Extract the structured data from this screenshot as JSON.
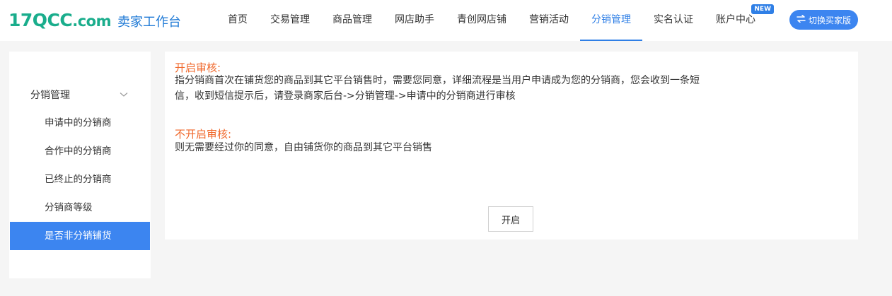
{
  "header": {
    "logo_text": "17QCC",
    "logo_domain": ".com",
    "logo_subtitle": "卖家工作台",
    "nav": [
      {
        "label": "首页",
        "active": false
      },
      {
        "label": "交易管理",
        "active": false
      },
      {
        "label": "商品管理",
        "active": false
      },
      {
        "label": "网店助手",
        "active": false
      },
      {
        "label": "青创网店铺",
        "active": false
      },
      {
        "label": "营销活动",
        "active": false
      },
      {
        "label": "分销管理",
        "active": true
      },
      {
        "label": "实名认证",
        "active": false
      },
      {
        "label": "账户中心",
        "active": false,
        "badge": "NEW"
      }
    ],
    "switch_button": "切换买家版",
    "switch_icon": "swap-icon"
  },
  "sidebar": {
    "group_label": "分销管理",
    "group_icon": "chevron-down-icon",
    "items": [
      {
        "label": "申请中的分销商",
        "active": false
      },
      {
        "label": "合作中的分销商",
        "active": false
      },
      {
        "label": "已终止的分销商",
        "active": false
      },
      {
        "label": "分销商等级",
        "active": false
      },
      {
        "label": "是否非分销铺货",
        "active": true
      }
    ]
  },
  "main": {
    "section1_title": "开启审核:",
    "section1_text_line1": "指分销商首次在铺货您的商品到其它平台销售时，需要您同意，详细流程是当用户申请成为您的分销商，您会收到一条短",
    "section1_text_line2": "信，收到短信提示后，请登录商家后台->分销管理->申请中的分销商进行审核",
    "section2_title": "不开启审核:",
    "section2_text": "则无需要经过你的同意，自由铺货你的商品到其它平台销售",
    "open_button": "开启"
  },
  "colors": {
    "accent": "#3c85f0",
    "warning_title": "#f0672a",
    "logo_green": "#1aad8c"
  }
}
